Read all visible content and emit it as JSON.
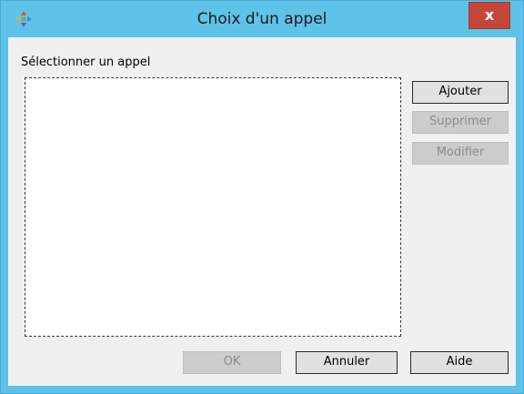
{
  "window": {
    "title": "Choix d'un appel",
    "close_label": "x"
  },
  "selector": {
    "label": "Sélectionner un appel",
    "items": []
  },
  "side_buttons": {
    "add": "Ajouter",
    "remove": "Supprimer",
    "edit": "Modifier"
  },
  "footer_buttons": {
    "ok": "OK",
    "cancel": "Annuler",
    "help": "Aide"
  },
  "colors": {
    "titlebar": "#5fc2e8",
    "close": "#c4463a",
    "dialog_bg": "#f0f0f0"
  },
  "icons": {
    "app": "app-logo-icon",
    "close": "close-icon"
  }
}
